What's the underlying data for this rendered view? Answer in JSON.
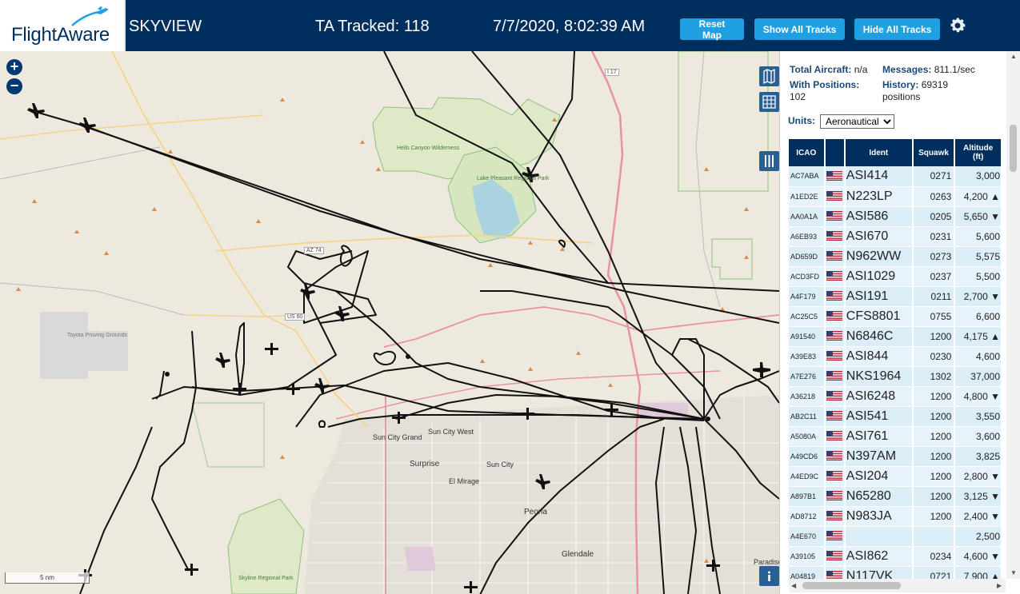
{
  "header": {
    "logo_text": "FlightAware",
    "title": "SKYVIEW",
    "tracked": "TA Tracked: 118",
    "datetime": "7/7/2020, 8:02:39 AM",
    "reset_label": "Reset Map",
    "show_label": "Show All Tracks",
    "hide_label": "Hide All Tracks",
    "brand_color": "#002f5d",
    "button_color": "#1ea0e2"
  },
  "map": {
    "zoom_in": "+",
    "zoom_out": "−",
    "scale": "5 nm",
    "labels": {
      "hells_canyon": "Hells Canyon Wilderness",
      "lake_pleasant": "Lake Pleasant Regional Park",
      "toyota": "Toyota Proving Grounds",
      "skyline": "Skyline Regional Park",
      "sun_city_grand": "Sun City Grand",
      "sun_city_west": "Sun City West",
      "sun_city": "Sun City",
      "surprise": "Surprise",
      "el_mirage": "El Mirage",
      "peoria": "Peoria",
      "glendale": "Glendale",
      "paradise": "Paradise",
      "az74": "AZ 74",
      "us60": "US 60",
      "i17": "I 17"
    }
  },
  "stats": {
    "total_label": "Total Aircraft:",
    "total_value": "n/a",
    "messages_label": "Messages:",
    "messages_value": "811.1/sec",
    "positions_label": "With Positions:",
    "positions_value": "102",
    "history_label": "History:",
    "history_value": "69319",
    "history_unit": "positions"
  },
  "units": {
    "label": "Units:",
    "selected": "Aeronautical"
  },
  "table": {
    "headers": {
      "icao": "ICAO",
      "ident": "Ident",
      "squawk": "Squawk",
      "altitude_line1": "Altitude",
      "altitude_line2": "(ft)"
    },
    "rows": [
      {
        "icao": "AC7ABA",
        "ident": "ASI414",
        "squawk": "0271",
        "altitude": "3,000"
      },
      {
        "icao": "A1ED2E",
        "ident": "N223LP",
        "squawk": "0263",
        "altitude": "4,200 ▲"
      },
      {
        "icao": "AA0A1A",
        "ident": "ASI586",
        "squawk": "0205",
        "altitude": "5,650 ▼"
      },
      {
        "icao": "A6EB93",
        "ident": "ASI670",
        "squawk": "0231",
        "altitude": "5,600"
      },
      {
        "icao": "AD659D",
        "ident": "N962WW",
        "squawk": "0273",
        "altitude": "5,575"
      },
      {
        "icao": "ACD3FD",
        "ident": "ASI1029",
        "squawk": "0237",
        "altitude": "5,500"
      },
      {
        "icao": "A4F179",
        "ident": "ASI191",
        "squawk": "0211",
        "altitude": "2,700 ▼"
      },
      {
        "icao": "AC25C5",
        "ident": "CFS8801",
        "squawk": "0755",
        "altitude": "6,600"
      },
      {
        "icao": "A91540",
        "ident": "N6846C",
        "squawk": "1200",
        "altitude": "4,175 ▲"
      },
      {
        "icao": "A39E83",
        "ident": "ASI844",
        "squawk": "0230",
        "altitude": "4,600"
      },
      {
        "icao": "A7E276",
        "ident": "NKS1964",
        "squawk": "1302",
        "altitude": "37,000"
      },
      {
        "icao": "A36218",
        "ident": "ASI6248",
        "squawk": "1200",
        "altitude": "4,800 ▼"
      },
      {
        "icao": "AB2C11",
        "ident": "ASI541",
        "squawk": "1200",
        "altitude": "3,550"
      },
      {
        "icao": "A5080A",
        "ident": "ASI761",
        "squawk": "1200",
        "altitude": "3,600"
      },
      {
        "icao": "A49CD6",
        "ident": "N397AM",
        "squawk": "1200",
        "altitude": "3,825"
      },
      {
        "icao": "A4ED9C",
        "ident": "ASI204",
        "squawk": "1200",
        "altitude": "2,800 ▼"
      },
      {
        "icao": "A897B1",
        "ident": "N65280",
        "squawk": "1200",
        "altitude": "3,125 ▼"
      },
      {
        "icao": "AD8712",
        "ident": "N983JA",
        "squawk": "1200",
        "altitude": "2,400 ▼"
      },
      {
        "icao": "A4E670",
        "ident": "",
        "squawk": "",
        "altitude": "2,500"
      },
      {
        "icao": "A39105",
        "ident": "ASI862",
        "squawk": "0234",
        "altitude": "4,600 ▼"
      },
      {
        "icao": "A04819",
        "ident": "N117VK",
        "squawk": "0721",
        "altitude": "7,900 ▲"
      }
    ]
  }
}
